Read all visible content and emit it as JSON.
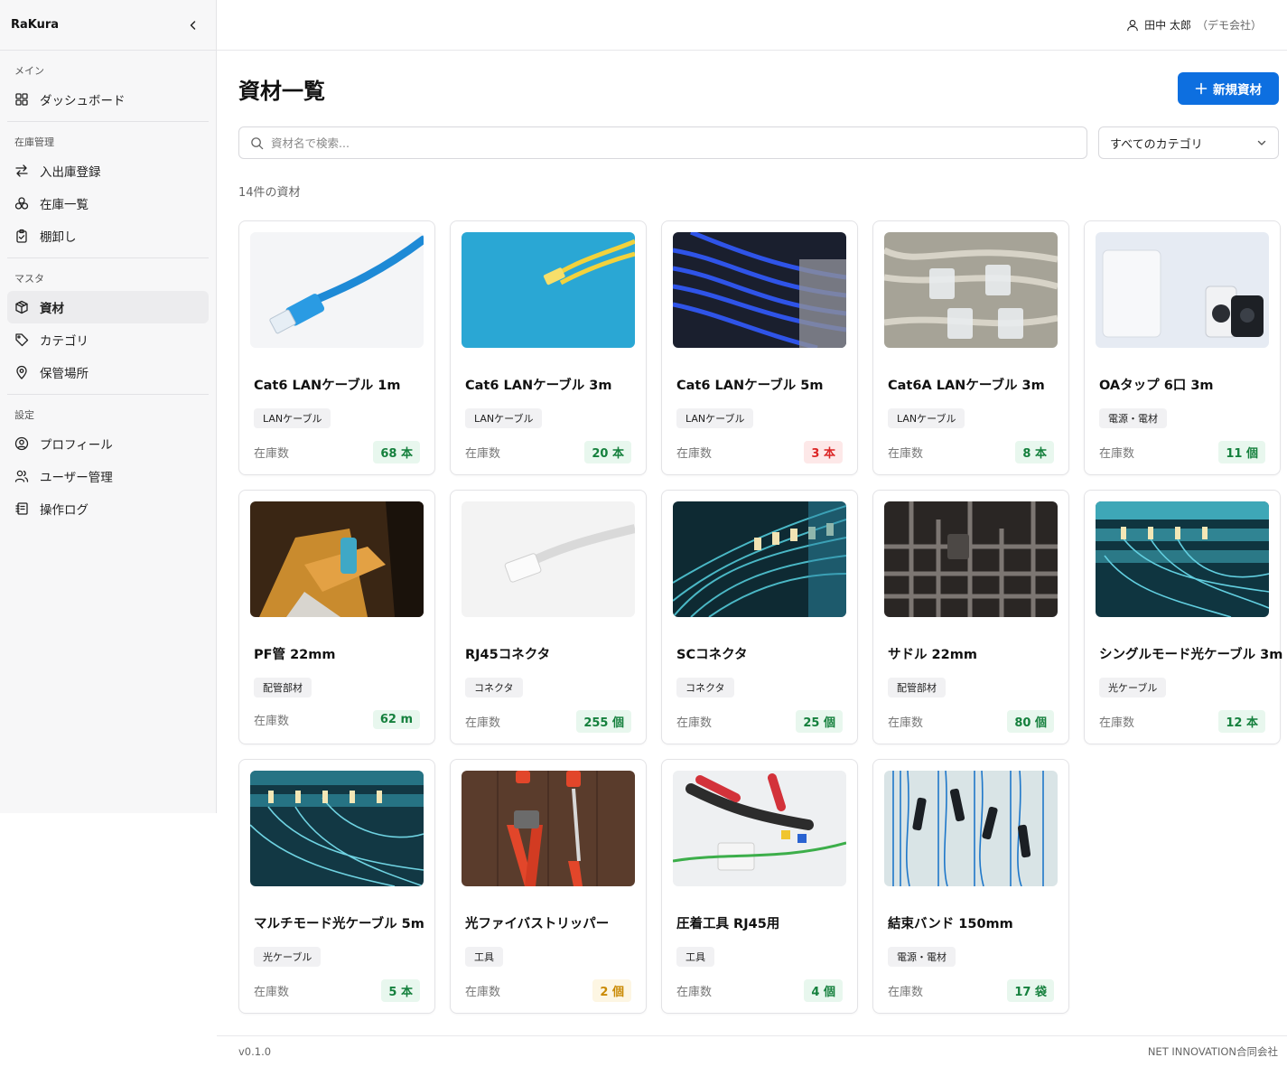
{
  "app": {
    "name": "RaKura"
  },
  "user": {
    "name": "田中 太郎",
    "company": "（デモ会社）"
  },
  "sidebar": {
    "sections": [
      {
        "title": "メイン",
        "items": [
          {
            "label": "ダッシュボード",
            "icon": "grid-icon"
          }
        ]
      },
      {
        "title": "在庫管理",
        "items": [
          {
            "label": "入出庫登録",
            "icon": "arrows-icon"
          },
          {
            "label": "在庫一覧",
            "icon": "boxes-icon"
          },
          {
            "label": "棚卸し",
            "icon": "clipboard-check-icon"
          }
        ]
      },
      {
        "title": "マスタ",
        "items": [
          {
            "label": "資材",
            "icon": "package-icon",
            "active": true
          },
          {
            "label": "カテゴリ",
            "icon": "tag-icon"
          },
          {
            "label": "保管場所",
            "icon": "map-pin-icon"
          }
        ]
      },
      {
        "title": "設定",
        "items": [
          {
            "label": "プロフィール",
            "icon": "user-circle-icon"
          },
          {
            "label": "ユーザー管理",
            "icon": "users-icon"
          },
          {
            "label": "操作ログ",
            "icon": "log-icon"
          }
        ]
      }
    ]
  },
  "page": {
    "title": "資材一覧",
    "new_button": "新規資材",
    "search_placeholder": "資材名で検索...",
    "category_filter": "すべてのカテゴリ",
    "count_text": "14件の資材",
    "stock_label": "在庫数"
  },
  "items": [
    {
      "name": "Cat6 LANケーブル 1m",
      "category": "LANケーブル",
      "stock": "68 本",
      "status": "ok",
      "image": "blue-lan-cable"
    },
    {
      "name": "Cat6 LANケーブル 3m",
      "category": "LANケーブル",
      "stock": "20 本",
      "status": "ok",
      "image": "yellow-lan-cable"
    },
    {
      "name": "Cat6 LANケーブル 5m",
      "category": "LANケーブル",
      "stock": "3 本",
      "status": "low",
      "image": "patch-panel-blue"
    },
    {
      "name": "Cat6A LANケーブル 3m",
      "category": "LANケーブル",
      "stock": "8 本",
      "status": "ok",
      "image": "rj-connectors-grey"
    },
    {
      "name": "OAタップ 6口 3m",
      "category": "電源・電材",
      "stock": "11 個",
      "status": "ok",
      "image": "power-adapters"
    },
    {
      "name": "PF管 22mm",
      "category": "配管部材",
      "stock": "62 m",
      "status": "ok",
      "image": "gloved-hand"
    },
    {
      "name": "RJ45コネクタ",
      "category": "コネクタ",
      "stock": "255 個",
      "status": "ok",
      "image": "white-connector"
    },
    {
      "name": "SCコネクタ",
      "category": "コネクタ",
      "stock": "25 個",
      "status": "ok",
      "image": "fiber-cyan"
    },
    {
      "name": "サドル 22mm",
      "category": "配管部材",
      "stock": "80 個",
      "status": "ok",
      "image": "metal-pipes"
    },
    {
      "name": "シングルモード光ケーブル 3m",
      "category": "光ケーブル",
      "stock": "12 本",
      "status": "ok",
      "image": "fiber-panel"
    },
    {
      "name": "マルチモード光ケーブル 5m",
      "category": "光ケーブル",
      "stock": "5 本",
      "status": "ok",
      "image": "fiber-panel-2"
    },
    {
      "name": "光ファイバストリッパー",
      "category": "工具",
      "stock": "2 個",
      "status": "warn",
      "image": "tools-wood"
    },
    {
      "name": "圧着工具 RJ45用",
      "category": "工具",
      "stock": "4 個",
      "status": "ok",
      "image": "crimp-tool"
    },
    {
      "name": "結束バンド 150mm",
      "category": "電源・電材",
      "stock": "17 袋",
      "status": "ok",
      "image": "blue-wires"
    }
  ],
  "footer": {
    "version": "v0.1.0",
    "company": "NET INNOVATION合同会社"
  },
  "colors": {
    "primary": "#0d6fe0",
    "ok": "#15803d",
    "low": "#dc2626",
    "warn": "#ca8a04"
  }
}
